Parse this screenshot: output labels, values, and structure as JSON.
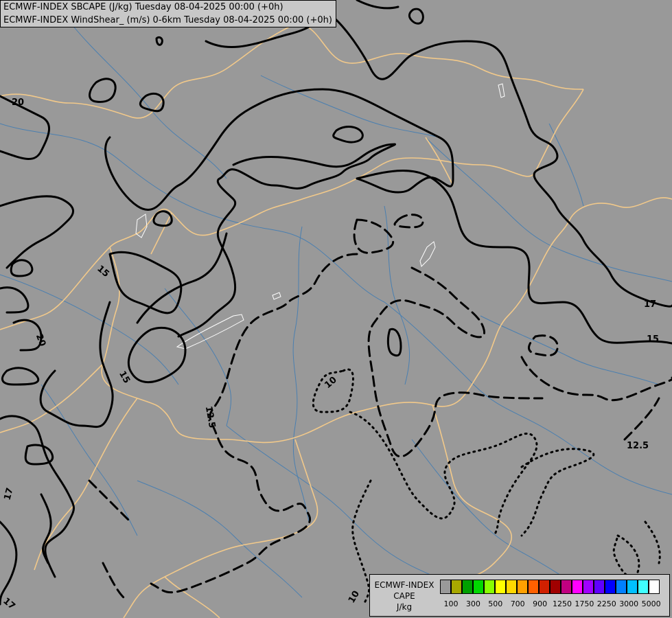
{
  "header": {
    "line1": "ECMWF-INDEX SBCAPE (J/kg) Tuesday 08-04-2025 00:00 (+0h)",
    "line2": "ECMWF-INDEX WindShear_ (m/s) 0-6km Tuesday 08-04-2025 00:00 (+0h)"
  },
  "contour_labels": {
    "c20a": "20",
    "c20b": "20",
    "c15a": "15",
    "c15b": "15",
    "c15c": "15",
    "c17a": "17",
    "c17b": "17",
    "c17c": "17",
    "c125a": "12.5",
    "c125b": "12.5",
    "c10a": "10",
    "c10b": "10"
  },
  "legend": {
    "title_line1": "ECMWF-INDEX",
    "title_line2": "CAPE",
    "title_line3": "J/kg",
    "colors": [
      "#999999",
      "#a8a800",
      "#00a000",
      "#00d800",
      "#88ff00",
      "#ffff00",
      "#ffd800",
      "#ffa000",
      "#ff6000",
      "#d02000",
      "#a00000",
      "#c00080",
      "#ff00ff",
      "#a000ff",
      "#6000ff",
      "#0000ff",
      "#0080ff",
      "#00c0ff",
      "#40ffff",
      "#ffffff"
    ],
    "ticks": [
      "100",
      "300",
      "500",
      "700",
      "900",
      "1250",
      "1750",
      "2250",
      "3000",
      "5000"
    ]
  },
  "colors": {
    "border": "#f2c98a",
    "river": "#4a7fb0",
    "contour": "#000000",
    "background": "#999999"
  }
}
